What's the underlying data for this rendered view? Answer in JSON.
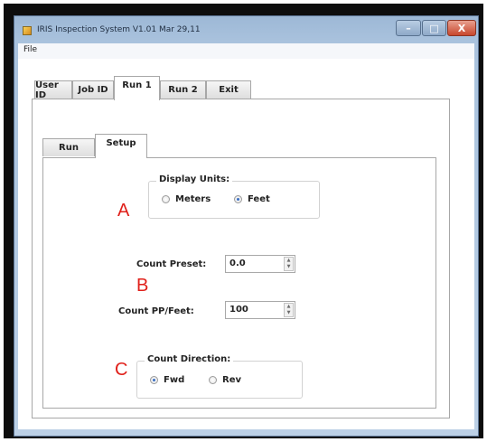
{
  "window": {
    "title": "IRIS Inspection System V1.01 Mar 29,11",
    "minimize_glyph": "–",
    "maximize_glyph": "□",
    "close_glyph": "X"
  },
  "menu": {
    "file": "File"
  },
  "outer_tabs": [
    {
      "label": "User ID"
    },
    {
      "label": "Job ID"
    },
    {
      "label": "Run 1"
    },
    {
      "label": "Run 2"
    },
    {
      "label": "Exit"
    }
  ],
  "outer_selected": "Run 1",
  "inner_tabs": [
    {
      "label": "Run"
    },
    {
      "label": "Setup"
    }
  ],
  "inner_selected": "Setup",
  "display_units": {
    "title": "Display Units:",
    "options": [
      "Meters",
      "Feet"
    ],
    "selected": "Feet"
  },
  "count_preset": {
    "label": "Count Preset:",
    "value": "0.0"
  },
  "count_pp": {
    "label": "Count PP/Feet:",
    "value": "100"
  },
  "count_direction": {
    "title": "Count Direction:",
    "options": [
      "Fwd",
      "Rev"
    ],
    "selected": "Fwd"
  },
  "annotations": {
    "a": "A",
    "b": "B",
    "c": "C"
  },
  "colors": {
    "annotation": "#e0201a",
    "radio_checked": "#3a6fc4",
    "title_bar": "#a9c2dd"
  },
  "icons": {
    "app": "app-icon",
    "spin_up": "chevron-up-icon",
    "spin_down": "chevron-down-icon"
  }
}
